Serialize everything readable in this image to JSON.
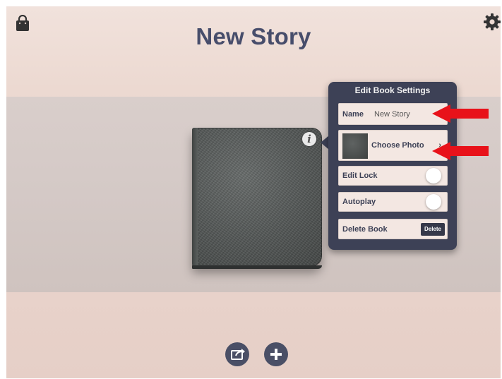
{
  "header": {
    "title": "New Story"
  },
  "popover": {
    "title": "Edit Book Settings",
    "name_label": "Name",
    "name_value": "New Story",
    "choose_photo_label": "Choose Photo",
    "chevron": "›",
    "edit_lock_label": "Edit Lock",
    "autoplay_label": "Autoplay",
    "delete_book_label": "Delete Book",
    "delete_button_label": "Delete"
  },
  "book": {
    "info_glyph": "i"
  },
  "icons": {
    "top_left": "shopping-bag-icon",
    "top_right": "gear-icon",
    "bottom_left": "share-icon",
    "bottom_right": "add-icon"
  },
  "colors": {
    "accent": "#474d6b",
    "popover": "#3d4156",
    "annotation": "#e8121a"
  }
}
